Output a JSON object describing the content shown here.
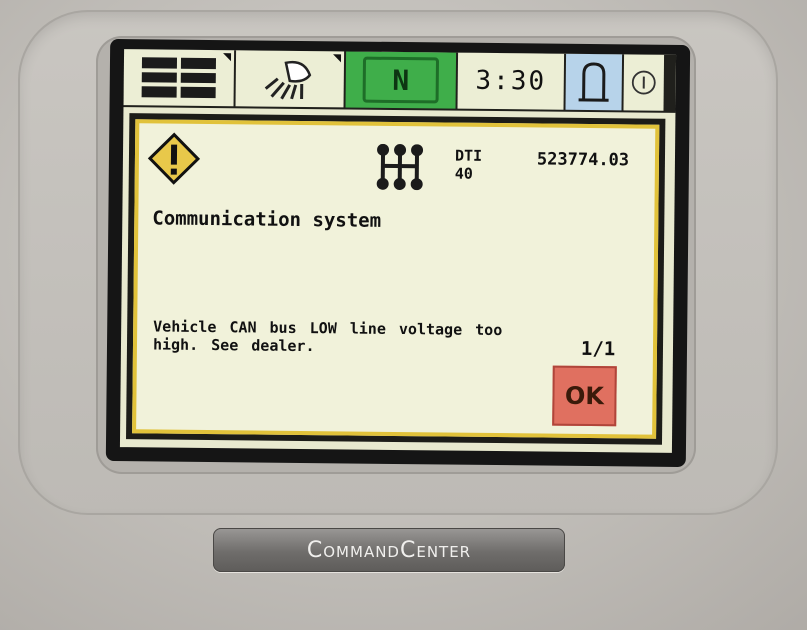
{
  "status_bar": {
    "gear": "N",
    "time": "3:30"
  },
  "alert": {
    "dti_label": "DTI",
    "dti_code": "40",
    "hours": "523774.03",
    "title": "Communication system",
    "message": "Vehicle CAN bus LOW line voltage too high. See dealer.",
    "page": "1/1",
    "ok_label": "OK"
  },
  "brand": {
    "name": "CommandCenter"
  },
  "colors": {
    "screen_bg": "#e8e9cf",
    "gear_cell": "#3fae4a",
    "alarm_cell": "#b7d3ea",
    "panel_border": "#e1c23a",
    "ok_button": "#e07060",
    "warning_fill": "#e8c84a"
  },
  "icons": {
    "menu": "menu-grid-icon",
    "lights": "work-light-icon",
    "alarm": "alarm-bell-icon",
    "info": "info-icon",
    "warning": "warning-diamond-icon",
    "transmission": "transmission-shift-icon"
  }
}
